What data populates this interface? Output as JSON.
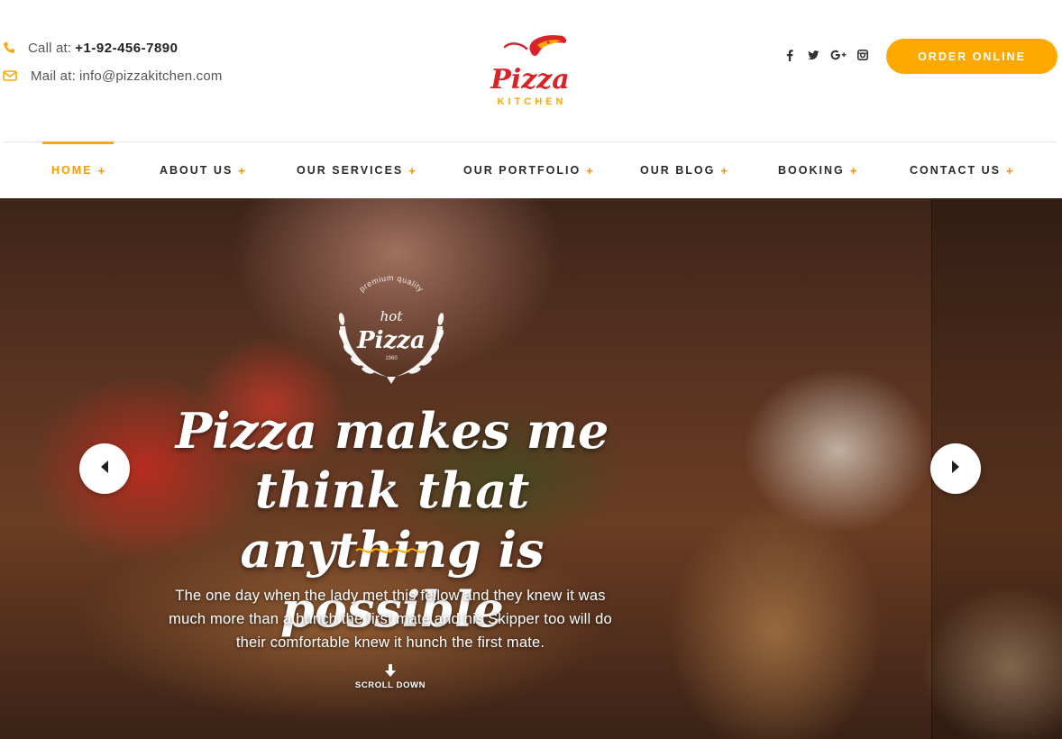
{
  "header": {
    "call_label": "Call at:",
    "call_value": "+1-92-456-7890",
    "mail_label": "Mail at:",
    "mail_value": "info@pizzakitchen.com",
    "logo_title": "Pizza",
    "logo_subtitle": "KITCHEN",
    "social_icons": [
      "facebook-icon",
      "twitter-icon",
      "google-plus-icon",
      "instagram-icon"
    ],
    "order_button": "ORDER ONLINE"
  },
  "nav": {
    "items": [
      {
        "label": "HOME",
        "active": true
      },
      {
        "label": "ABOUT US",
        "active": false
      },
      {
        "label": "OUR SERVICES",
        "active": false
      },
      {
        "label": "OUR PORTFOLIO",
        "active": false
      },
      {
        "label": "OUR BLOG",
        "active": false
      },
      {
        "label": "BOOKING",
        "active": false
      },
      {
        "label": "CONTACT US",
        "active": false
      }
    ],
    "expand_symbol": "+"
  },
  "hero": {
    "badge": {
      "top_text": "premium quality",
      "line1": "hot",
      "line2": "Pizza",
      "line3": "1960"
    },
    "headline_line1": "Pizza makes me think that",
    "headline_line2": "anything is possible",
    "description": "The one day when the lady met this fellow and they knew it was much more than a hunch the first mate and his Skipper too will do their comfortable knew it hunch the first mate.",
    "scroll_label": "SCROLL DOWN"
  },
  "colors": {
    "accent": "#ffa800",
    "nav_plus": "#ff8a00",
    "logo_red": "#d8232a"
  }
}
